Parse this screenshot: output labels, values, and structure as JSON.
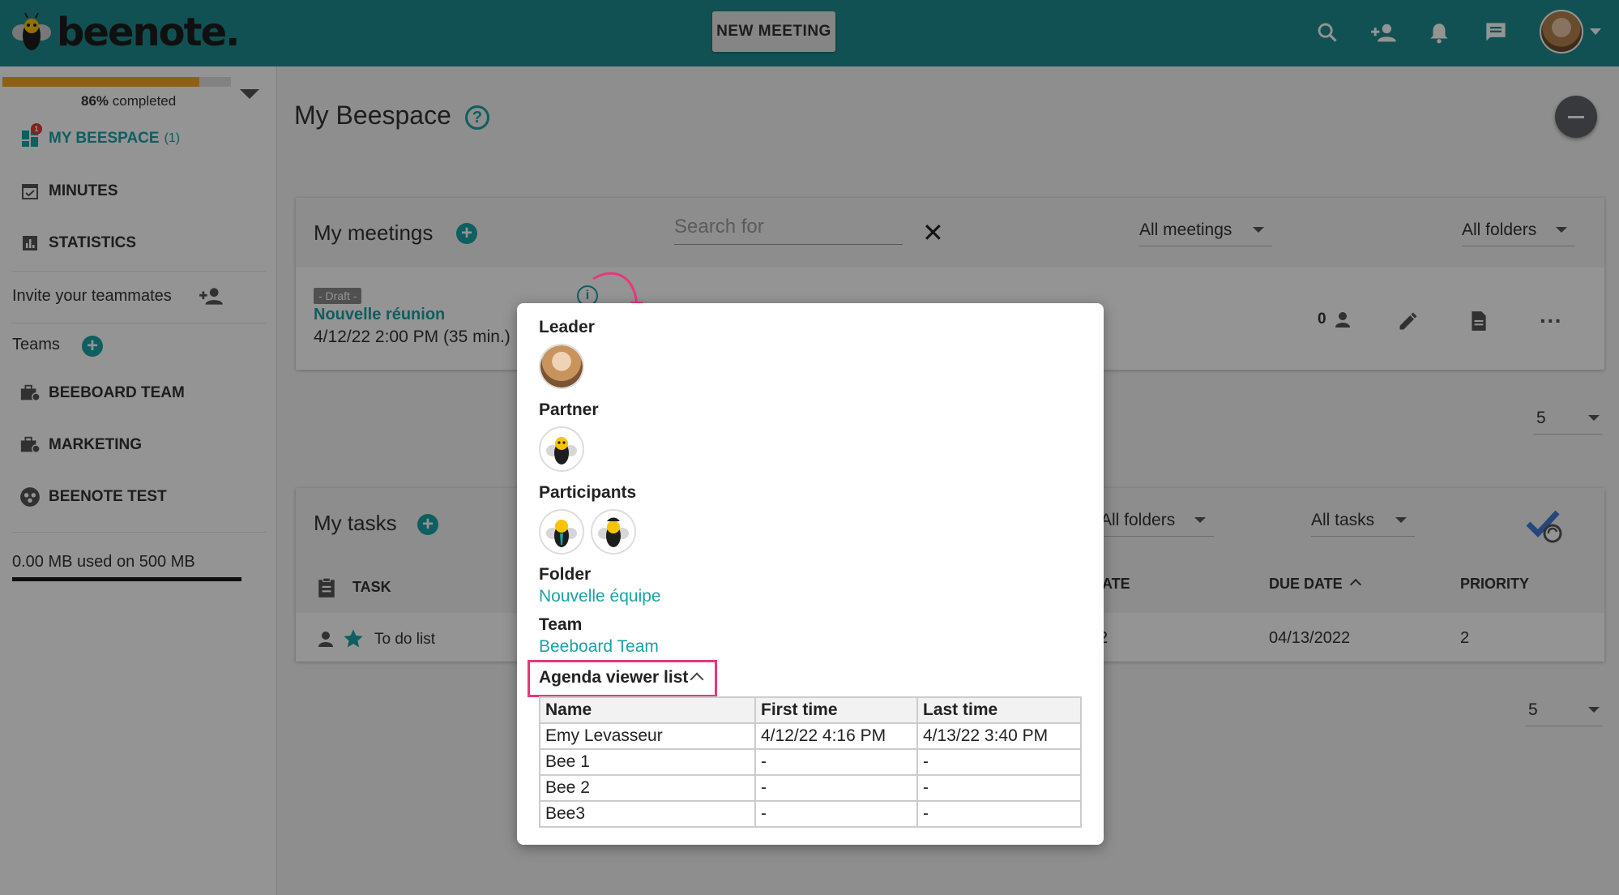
{
  "app": {
    "brand": "beenote."
  },
  "topbar": {
    "new_meeting": "NEW MEETING"
  },
  "sidebar": {
    "progress_value": "86%",
    "progress_suffix": "completed",
    "progress_fraction": 0.86,
    "items": [
      {
        "label": "MY BEESPACE",
        "count": "(1)",
        "badge": "1"
      },
      {
        "label": "MINUTES"
      },
      {
        "label": "STATISTICS"
      }
    ],
    "invite": "Invite your teammates",
    "teams_label": "Teams",
    "teams": [
      {
        "label": "BEEBOARD TEAM"
      },
      {
        "label": "MARKETING"
      },
      {
        "label": "BEENOTE TEST"
      }
    ],
    "storage": "0.00 MB used on 500 MB"
  },
  "main": {
    "title": "My Beespace",
    "meetings": {
      "title": "My meetings",
      "search_placeholder": "Search for",
      "filter_meetings": "All meetings",
      "filter_folders": "All folders",
      "row": {
        "tag": "- Draft -",
        "title": "Nouvelle réunion",
        "date": "4/12/22 2:00 PM (35 min.)",
        "participants": "0"
      },
      "pager": "5"
    },
    "tasks": {
      "title": "My tasks",
      "filter_folders": "All folders",
      "filter_tasks": "All tasks",
      "columns": {
        "task": "TASK",
        "date": "ATE",
        "due": "DUE DATE",
        "priority": "PRIORITY"
      },
      "row": {
        "name": "To do list",
        "date": "2",
        "due": "04/13/2022",
        "priority": "2"
      },
      "pager": "5"
    }
  },
  "popup": {
    "leader": "Leader",
    "partner": "Partner",
    "participants": "Participants",
    "folder_label": "Folder",
    "folder_value": "Nouvelle équipe",
    "team_label": "Team",
    "team_value": "Beeboard Team",
    "agenda_label": "Agenda viewer list",
    "table": {
      "headers": [
        "Name",
        "First time",
        "Last time"
      ],
      "rows": [
        [
          "Emy Levasseur",
          "4/12/22 4:16 PM",
          "4/13/22 3:40 PM"
        ],
        [
          "Bee 1",
          "-",
          "-"
        ],
        [
          "Bee 2",
          "-",
          "-"
        ],
        [
          "Bee3",
          "-",
          "-"
        ]
      ]
    }
  },
  "colors": {
    "topbar": "#208c8f",
    "accent": "#1aa2a6",
    "highlight": "#e8387a",
    "progress": "#f4a623"
  }
}
